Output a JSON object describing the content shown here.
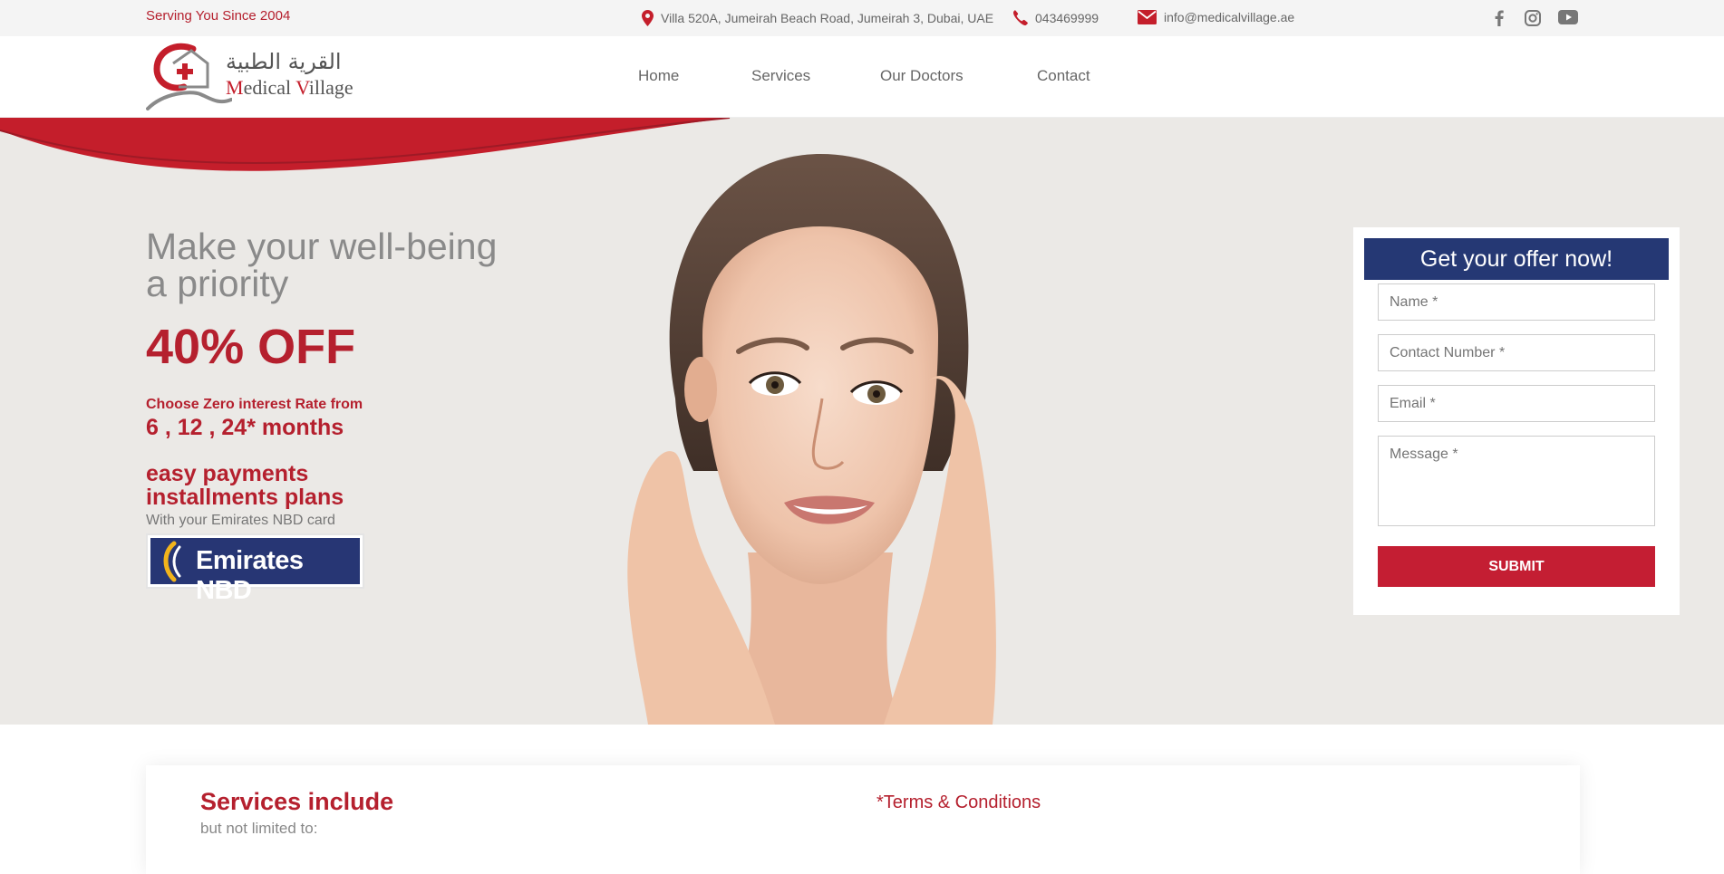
{
  "topbar": {
    "tagline": "Serving You Since 2004",
    "address": "Villa 520A, Jumeirah Beach Road, Jumeirah 3, Dubai, UAE",
    "phone": "043469999",
    "email": "info@medicalvillage.ae",
    "social": [
      "facebook-icon",
      "instagram-icon",
      "youtube-icon"
    ]
  },
  "brand": {
    "arabic_name": "القرية الطبية",
    "latin_first_initial": "M",
    "latin_first_rest": "edical ",
    "latin_second_initial": "V",
    "latin_second_rest": "illage"
  },
  "nav": {
    "home": "Home",
    "services": "Services",
    "doctors": "Our Doctors",
    "contact": "Contact"
  },
  "hero": {
    "headline_line1": "Make your well-being",
    "headline_line2": "a priority",
    "offer": "40% OFF",
    "rate_label": "Choose Zero interest Rate from",
    "rate_months": "6 , 12 , 24* months",
    "easy_line1": "easy payments",
    "easy_line2": "installments plans",
    "card_text": "With your Emirates NBD card",
    "bank_logo_text": "Emirates NBD"
  },
  "form": {
    "title": "Get your offer now!",
    "name_placeholder": "Name *",
    "contact_placeholder": "Contact Number *",
    "email_placeholder": "Email *",
    "message_placeholder": "Message *",
    "submit_label": "SUBMIT"
  },
  "lower": {
    "services_title": "Services include",
    "services_sub": "but not limited to:",
    "terms": "*Terms & Conditions"
  },
  "colors": {
    "brand_red": "#b5202e",
    "navy": "#253874",
    "hero_bg": "#ebe9e6"
  }
}
